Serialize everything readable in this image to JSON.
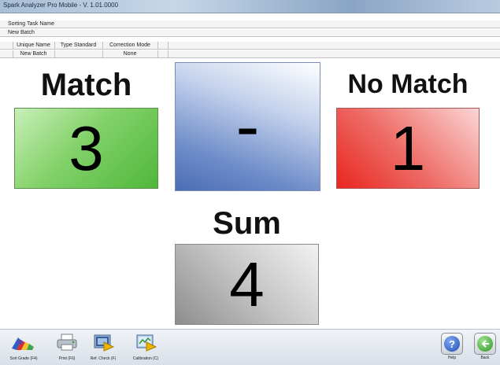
{
  "window": {
    "title": "Spark Analyzer Pro Mobile - V. 1.01.0000"
  },
  "info": {
    "task_label": "Sorting Task Name",
    "batch_label": "New Batch"
  },
  "grid": {
    "headers": [
      "Unique Name",
      "Type Standard",
      "Correction Mode"
    ],
    "row": [
      "New Batch",
      "",
      "None"
    ]
  },
  "panels": {
    "match": {
      "label": "Match",
      "value": "3",
      "color": "#6cc755"
    },
    "result": {
      "value": "-",
      "color": "#5a7bbf"
    },
    "no_match": {
      "label": "No Match",
      "value": "1",
      "color": "#e8352e"
    },
    "sum": {
      "label": "Sum",
      "value": "4",
      "color": "#a9a9a9"
    }
  },
  "toolbar": {
    "sort_grade": "Sort Grade (F4)",
    "print": "Print (F6)",
    "ref_check": "Ref. Check (F)",
    "calibration": "Calibration (C)",
    "help": "Help",
    "back": "Back"
  },
  "icons": [
    "sort-grade-icon",
    "printer-icon",
    "ref-check-icon",
    "calibration-icon",
    "help-icon",
    "back-arrow-icon"
  ]
}
